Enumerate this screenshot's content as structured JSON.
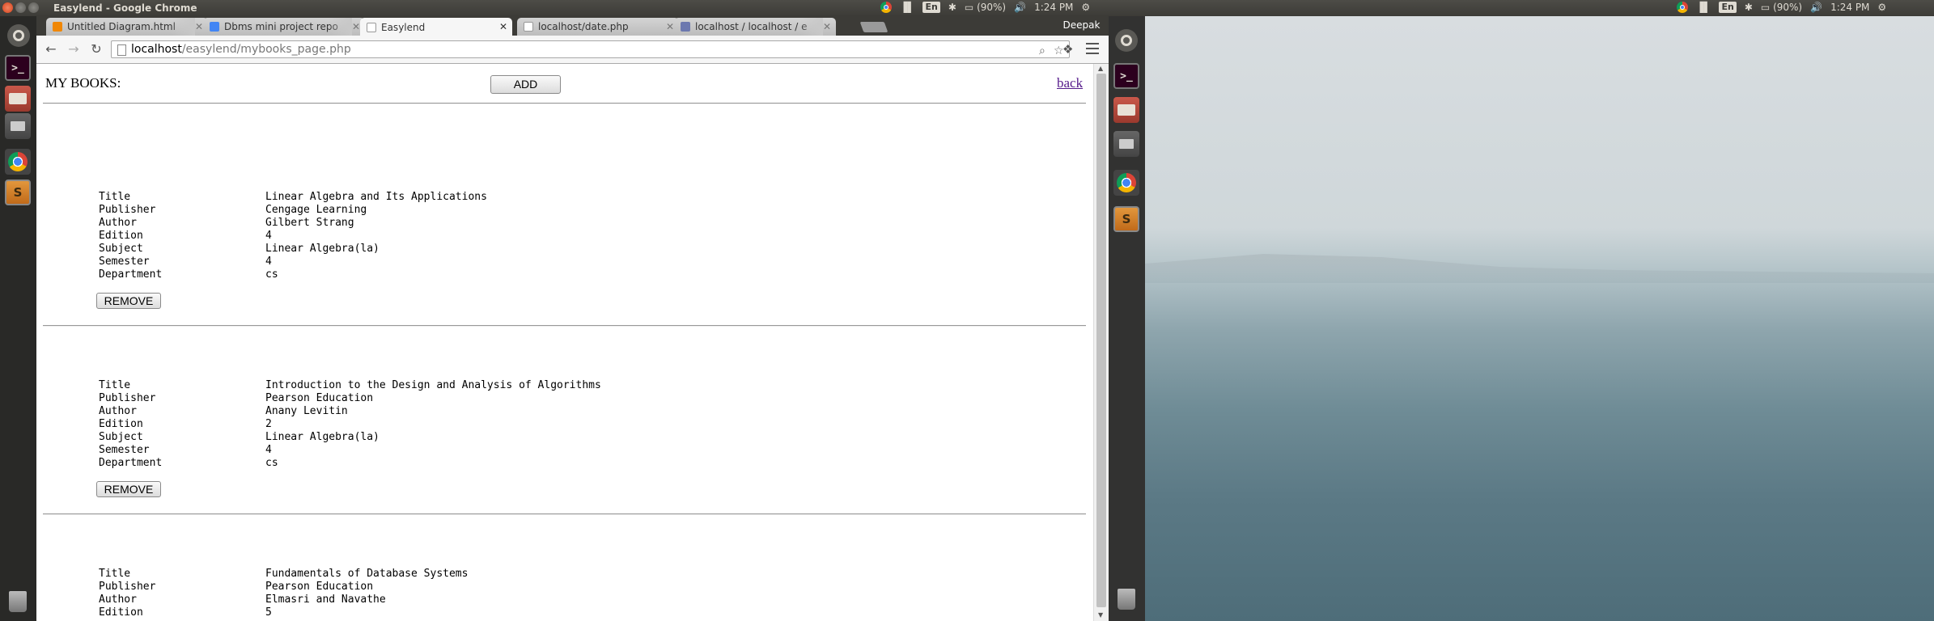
{
  "window": {
    "title": "Easylend - Google Chrome"
  },
  "system": {
    "battery": "(90%)",
    "time": "1:24 PM",
    "lang": "En",
    "user": "Deepak"
  },
  "tabs": [
    {
      "label": "Untitled Diagram.html",
      "icon": "drawio-icon"
    },
    {
      "label": "Dbms mini project repo",
      "icon": "google-docs-icon"
    },
    {
      "label": "Easylend",
      "icon": "page-icon",
      "active": true
    },
    {
      "label": "localhost/date.php",
      "icon": "page-icon"
    },
    {
      "label": "localhost / localhost / e",
      "icon": "phpmyadmin-icon"
    }
  ],
  "omnibox": {
    "host": "localhost",
    "path": "/easylend/mybooks_page.php"
  },
  "page": {
    "heading": "MY BOOKS:",
    "add_label": "ADD",
    "back_label": "back",
    "remove_label": "REMOVE",
    "labels": [
      "Title",
      "Publisher",
      "Author",
      "Edition",
      "Subject",
      "Semester",
      "Department"
    ],
    "books": [
      {
        "values": [
          "Linear Algebra and Its Applications",
          "Cengage Learning",
          "Gilbert Strang",
          "4",
          "Linear Algebra(la)",
          "4",
          "cs"
        ]
      },
      {
        "values": [
          "Introduction to the Design and Analysis of Algorithms",
          "Pearson Education",
          "Anany Levitin",
          "2",
          "Linear Algebra(la)",
          "4",
          "cs"
        ]
      },
      {
        "values": [
          "Fundamentals of Database Systems",
          "Pearson Education",
          "Elmasri and Navathe",
          "5"
        ]
      }
    ]
  }
}
